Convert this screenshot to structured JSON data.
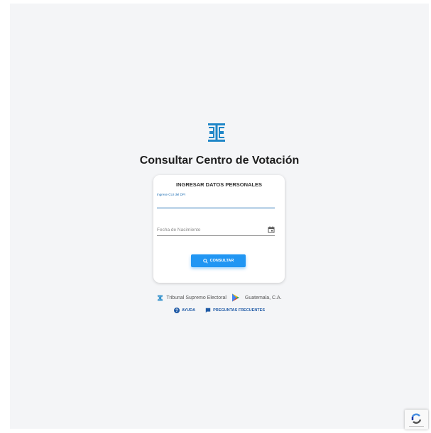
{
  "page": {
    "title": "Consultar Centro de Votación"
  },
  "form": {
    "heading": "INGRESAR DATOS PERSONALES",
    "dpi_label": "Ingrese CUI del DPI",
    "dpi_value": "",
    "date_placeholder": "Fecha de Nacimiento",
    "submit_label": "CONSULTAR"
  },
  "footer": {
    "org": "Tribunal Supremo Electoral",
    "location": "Guatemala, C.A.",
    "help_label": "AYUDA",
    "faq_label": "PREGUNTAS FRECUENTES"
  },
  "icons": {
    "logo": "tse-logo-icon",
    "calendar": "calendar-icon",
    "search": "search-icon",
    "help": "help-circle-icon",
    "faq": "chat-icon",
    "play_store": "play-store-icon",
    "recaptcha": "recaptcha-icon"
  },
  "colors": {
    "accent": "#2196f3",
    "link": "#1f5aa6",
    "background": "#f4f5f7"
  }
}
